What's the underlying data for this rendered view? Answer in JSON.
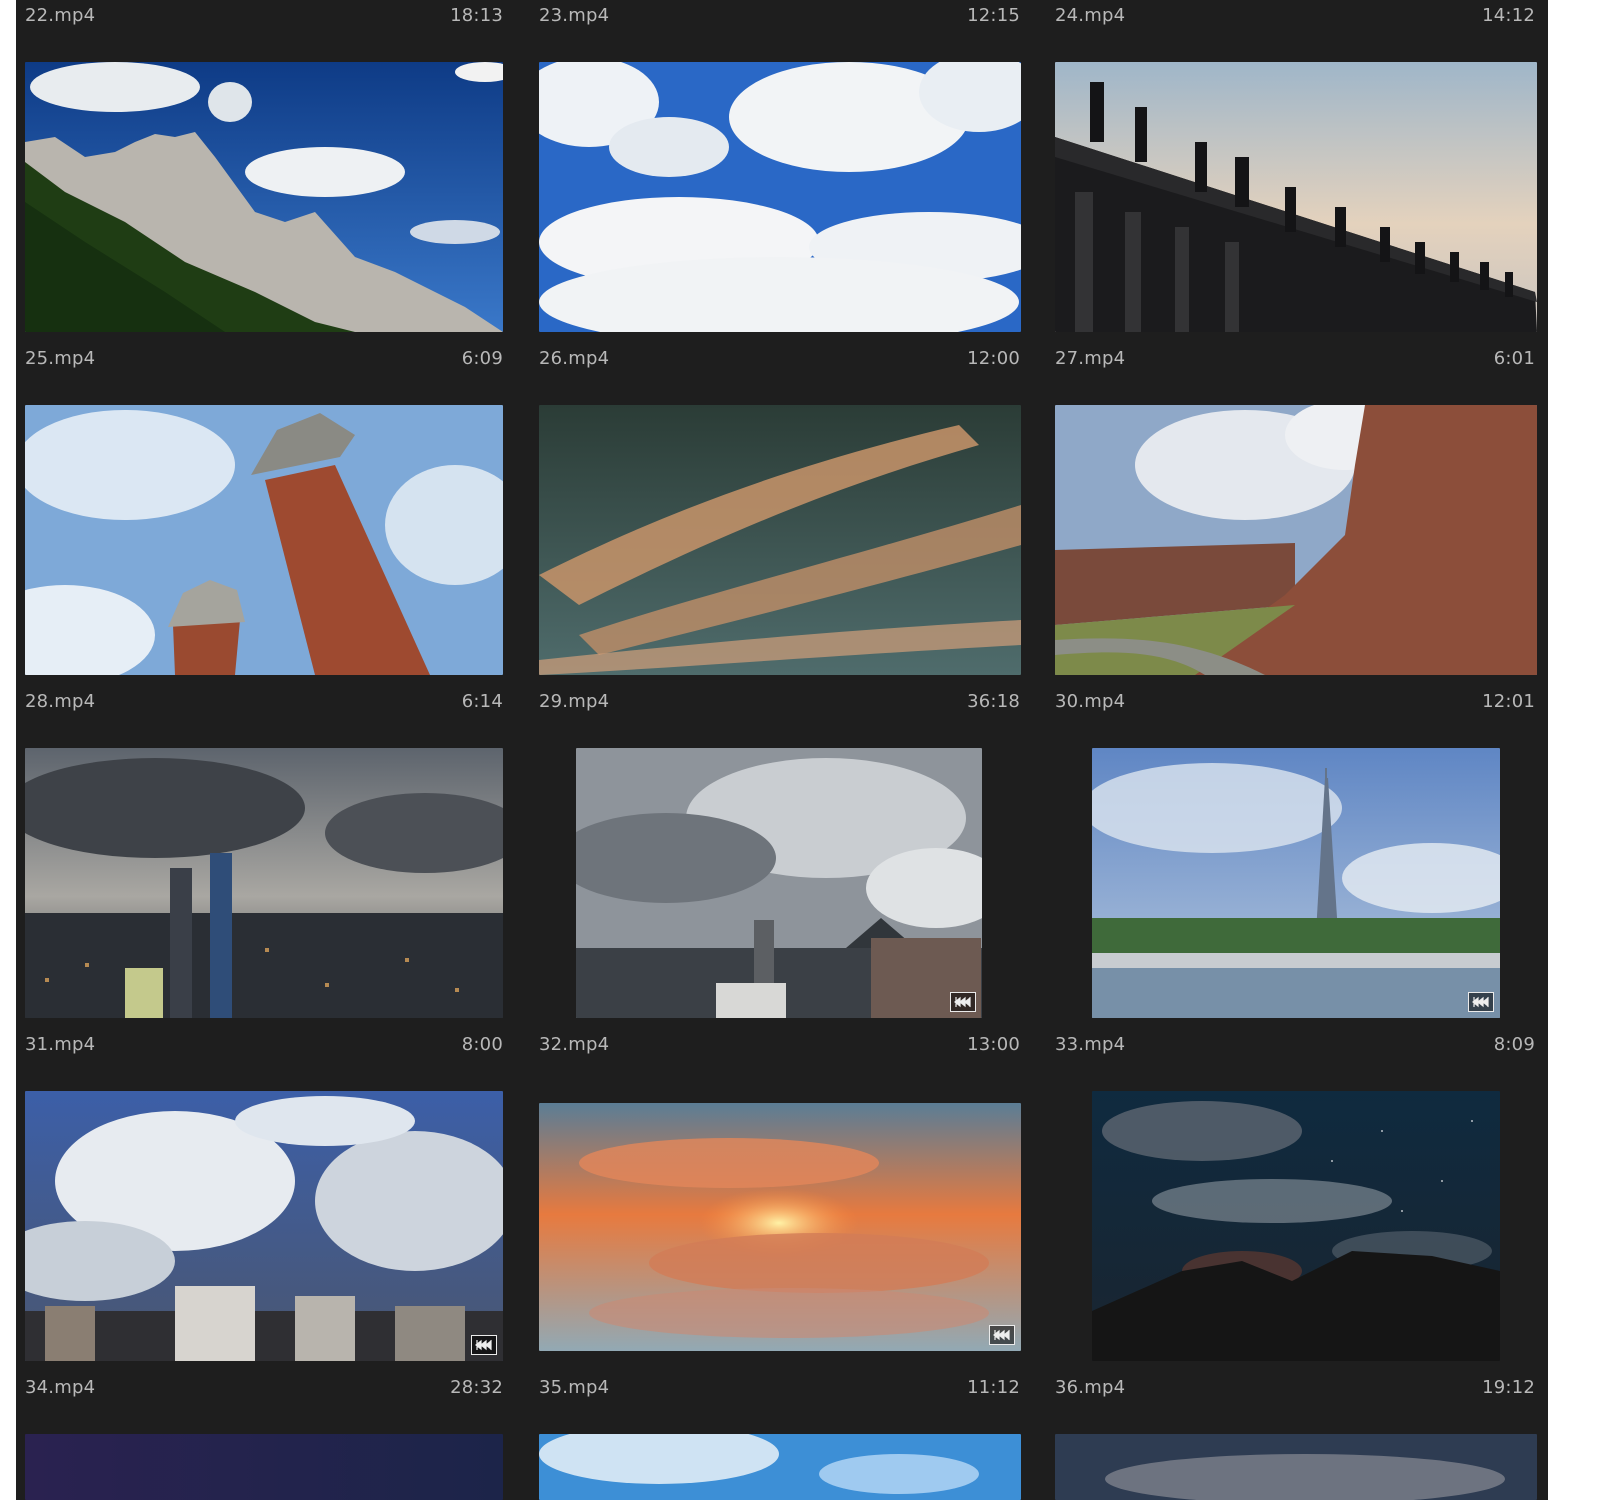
{
  "clips": [
    {
      "name": "22.mp4",
      "duration": "18:13",
      "icon": "video-thumbnail"
    },
    {
      "name": "23.mp4",
      "duration": "12:15",
      "icon": "video-thumbnail"
    },
    {
      "name": "24.mp4",
      "duration": "14:12",
      "icon": "video-thumbnail"
    },
    {
      "name": "25.mp4",
      "duration": "6:09",
      "icon": "mountain-thumbnail",
      "scene": "mountain",
      "badge": false
    },
    {
      "name": "26.mp4",
      "duration": "12:00",
      "icon": "clouds-thumbnail",
      "scene": "clouds",
      "badge": false
    },
    {
      "name": "27.mp4",
      "duration": "6:01",
      "icon": "colonnade-thumbnail",
      "scene": "statues",
      "badge": false
    },
    {
      "name": "28.mp4",
      "duration": "6:14",
      "icon": "towers-thumbnail",
      "scene": "towers",
      "badge": false
    },
    {
      "name": "29.mp4",
      "duration": "36:18",
      "icon": "sunset-clouds-thumbnail",
      "scene": "streaks",
      "badge": false
    },
    {
      "name": "30.mp4",
      "duration": "12:01",
      "icon": "canyon-thumbnail",
      "scene": "canyon",
      "badge": false
    },
    {
      "name": "31.mp4",
      "duration": "8:00",
      "icon": "city-skyline-thumbnail",
      "scene": "city",
      "badge": false
    },
    {
      "name": "32.mp4",
      "duration": "13:00",
      "icon": "overcast-city-thumbnail",
      "scene": "overcast",
      "badge": true
    },
    {
      "name": "33.mp4",
      "duration": "8:09",
      "icon": "tv-tower-thumbnail",
      "scene": "tower",
      "badge": true
    },
    {
      "name": "34.mp4",
      "duration": "28:32",
      "icon": "storm-clouds-thumbnail",
      "scene": "cumulus",
      "badge": true
    },
    {
      "name": "35.mp4",
      "duration": "11:12",
      "icon": "sunrise-thumbnail",
      "scene": "sunrise",
      "badge": true
    },
    {
      "name": "36.mp4",
      "duration": "19:12",
      "icon": "night-sky-thumbnail",
      "scene": "night",
      "badge": false
    }
  ],
  "colors": {
    "panel_bg": "#1e1e1e",
    "caption_text": "#b8b8b8"
  }
}
